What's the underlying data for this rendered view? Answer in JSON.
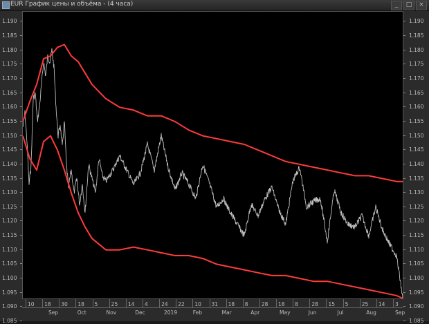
{
  "window": {
    "title": "EUR График цены и объёма - (4 часа)",
    "buttons": {
      "minimize": "_",
      "maximize": "□",
      "close": "×"
    }
  },
  "colors": {
    "background": "#000000",
    "price": "#bdbdbd",
    "bands": "#ff3b3b",
    "frame": "#2b2b2b"
  },
  "chart_data": {
    "type": "line",
    "title": "",
    "xlabel": "",
    "ylabel": "",
    "ylim": [
      1.0925,
      1.1935
    ],
    "y_ticks": [
      "1.190",
      "1.185",
      "1.180",
      "1.175",
      "1.170",
      "1.165",
      "1.160",
      "1.155",
      "1.150",
      "1.145",
      "1.140",
      "1.135",
      "1.130",
      "1.125",
      "1.120",
      "1.115",
      "1.110",
      "1.105",
      "1.100",
      "1.095",
      "1.090",
      "1.085"
    ],
    "x_tick_labels": [
      "10",
      "18",
      "30",
      "18",
      "5",
      "25",
      "14",
      "4",
      "24",
      "22",
      "10",
      "31",
      "18",
      "8",
      "28",
      "18",
      "8",
      "28",
      "15",
      "5",
      "25",
      "14",
      "3"
    ],
    "x_month_labels": [
      "Sep",
      "Oct",
      "Nov",
      "Dec",
      "2019",
      "Feb",
      "Mar",
      "Apr",
      "May",
      "Jun",
      "Jul",
      "Aug",
      "Sep"
    ],
    "grid": false,
    "series": [
      {
        "values_x": [
          0,
          3,
          6,
          9,
          12,
          15,
          18,
          21,
          24,
          27,
          30,
          33,
          36,
          39,
          42,
          45,
          48,
          51,
          54,
          57,
          60,
          63,
          66,
          70,
          74,
          78,
          82,
          86,
          90,
          95,
          100,
          105,
          110,
          115,
          120,
          130,
          140,
          150,
          160,
          170,
          180,
          190,
          200,
          210,
          220,
          230,
          240,
          250,
          260,
          270,
          280,
          290,
          300,
          310,
          320,
          330,
          340,
          350,
          360,
          370,
          380,
          390,
          400,
          410,
          420,
          430,
          440,
          450,
          460,
          470,
          480,
          490,
          500,
          510,
          520,
          530,
          540,
          545,
          549
        ],
        "values": [
          1.153,
          1.158,
          1.148,
          1.133,
          1.14,
          1.163,
          1.165,
          1.155,
          1.16,
          1.168,
          1.176,
          1.171,
          1.178,
          1.176,
          1.18,
          1.174,
          1.16,
          1.15,
          1.154,
          1.146,
          1.155,
          1.14,
          1.132,
          1.138,
          1.13,
          1.135,
          1.126,
          1.133,
          1.123,
          1.14,
          1.135,
          1.13,
          1.142,
          1.136,
          1.134,
          1.138,
          1.143,
          1.138,
          1.133,
          1.137,
          1.147,
          1.138,
          1.15,
          1.139,
          1.131,
          1.137,
          1.133,
          1.128,
          1.14,
          1.133,
          1.125,
          1.128,
          1.123,
          1.119,
          1.115,
          1.126,
          1.122,
          1.128,
          1.132,
          1.124,
          1.119,
          1.134,
          1.139,
          1.125,
          1.127,
          1.128,
          1.113,
          1.131,
          1.123,
          1.119,
          1.118,
          1.122,
          1.115,
          1.125,
          1.117,
          1.112,
          1.108,
          1.1,
          1.093
        ]
      },
      {
        "values_x": [
          0,
          10,
          20,
          30,
          40,
          50,
          60,
          70,
          80,
          90,
          100,
          120,
          140,
          160,
          180,
          200,
          220,
          240,
          260,
          280,
          300,
          320,
          340,
          360,
          380,
          400,
          420,
          440,
          460,
          480,
          500,
          520,
          540,
          549
        ],
        "values": [
          1.155,
          1.162,
          1.168,
          1.177,
          1.178,
          1.181,
          1.182,
          1.178,
          1.176,
          1.172,
          1.168,
          1.163,
          1.16,
          1.159,
          1.157,
          1.157,
          1.155,
          1.152,
          1.15,
          1.149,
          1.148,
          1.147,
          1.145,
          1.143,
          1.141,
          1.14,
          1.139,
          1.138,
          1.137,
          1.136,
          1.136,
          1.135,
          1.134,
          1.134
        ]
      },
      {
        "values_x": [
          0,
          10,
          20,
          30,
          40,
          50,
          60,
          70,
          80,
          90,
          100,
          120,
          140,
          160,
          180,
          200,
          220,
          240,
          260,
          280,
          300,
          320,
          340,
          360,
          380,
          400,
          420,
          440,
          460,
          480,
          500,
          520,
          540,
          549
        ],
        "values": [
          1.15,
          1.142,
          1.138,
          1.148,
          1.15,
          1.145,
          1.138,
          1.13,
          1.123,
          1.118,
          1.114,
          1.11,
          1.11,
          1.111,
          1.11,
          1.109,
          1.108,
          1.108,
          1.107,
          1.105,
          1.104,
          1.103,
          1.102,
          1.101,
          1.101,
          1.1,
          1.099,
          1.099,
          1.098,
          1.097,
          1.096,
          1.095,
          1.094,
          1.093
        ]
      }
    ]
  }
}
